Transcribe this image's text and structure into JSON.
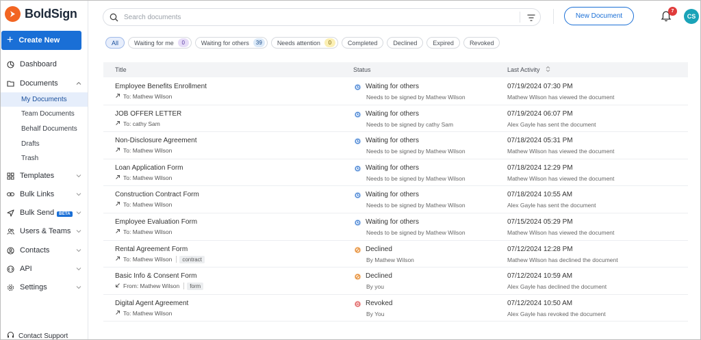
{
  "brand": {
    "name": "BoldSign",
    "accent": "#1a6fd6",
    "logo_color": "#f26522"
  },
  "sidebar": {
    "create_label": "Create New",
    "items": [
      {
        "label": "Dashboard",
        "icon": "dashboard-icon"
      },
      {
        "label": "Documents",
        "icon": "folder-icon"
      },
      {
        "label": "Templates",
        "icon": "grid-icon"
      },
      {
        "label": "Bulk Links",
        "icon": "link-icon"
      },
      {
        "label": "Bulk Send",
        "icon": "send-icon",
        "badge": "BETA"
      },
      {
        "label": "Users & Teams",
        "icon": "users-icon"
      },
      {
        "label": "Contacts",
        "icon": "contacts-icon"
      },
      {
        "label": "API",
        "icon": "api-icon"
      },
      {
        "label": "Settings",
        "icon": "gear-icon"
      }
    ],
    "documents_sub": [
      "My Documents",
      "Team Documents",
      "Behalf Documents",
      "Drafts",
      "Trash"
    ],
    "support_label": "Contact Support"
  },
  "header": {
    "search_placeholder": "Search documents",
    "new_document_label": "New Document",
    "notification_count": "7",
    "user_initials": "CS"
  },
  "filters": [
    {
      "label": "All"
    },
    {
      "label": "Waiting for me",
      "count": "0"
    },
    {
      "label": "Waiting for others",
      "count": "39"
    },
    {
      "label": "Needs attention",
      "count": "0"
    },
    {
      "label": "Completed"
    },
    {
      "label": "Declined"
    },
    {
      "label": "Expired"
    },
    {
      "label": "Revoked"
    }
  ],
  "table": {
    "columns": {
      "title": "Title",
      "status": "Status",
      "last_activity": "Last Activity"
    },
    "rows": [
      {
        "title": "Employee Benefits Enrollment",
        "party": "To: Mathew Wilson",
        "status": "Waiting for others",
        "status_detail": "Needs to be signed by Mathew Wilson",
        "date": "07/19/2024 07:30 PM",
        "activity": "Mathew Wilson has viewed the document"
      },
      {
        "title": "JOB OFFER LETTER",
        "party": "To: cathy Sam",
        "status": "Waiting for others",
        "status_detail": "Needs to be signed by cathy Sam",
        "date": "07/19/2024 06:07 PM",
        "activity": "Alex Gayle has sent the document"
      },
      {
        "title": "Non-Disclosure Agreement",
        "party": "To: Mathew Wilson",
        "status": "Waiting for others",
        "status_detail": "Needs to be signed by Mathew Wilson",
        "date": "07/18/2024 05:31 PM",
        "activity": "Mathew Wilson has viewed the document"
      },
      {
        "title": "Loan Application Form",
        "party": "To: Mathew Wilson",
        "status": "Waiting for others",
        "status_detail": "Needs to be signed by Mathew Wilson",
        "date": "07/18/2024 12:29 PM",
        "activity": "Mathew Wilson has viewed the document"
      },
      {
        "title": "Construction Contract Form",
        "party": "To: Mathew Wilson",
        "status": "Waiting for others",
        "status_detail": "Needs to be signed by Mathew Wilson",
        "date": "07/18/2024 10:55 AM",
        "activity": "Alex Gayle has sent the document"
      },
      {
        "title": "Employee Evaluation Form",
        "party": "To: Mathew Wilson",
        "status": "Waiting for others",
        "status_detail": "Needs to be signed by Mathew Wilson",
        "date": "07/15/2024 05:29 PM",
        "activity": "Mathew Wilson has viewed the document"
      },
      {
        "title": "Rental Agreement Form",
        "party": "To: Mathew Wilson",
        "tag": "contract",
        "status": "Declined",
        "status_detail": "By Mathew Wilson",
        "date": "07/12/2024 12:28 PM",
        "activity": "Mathew Wilson has declined the document"
      },
      {
        "title": "Basic Info & Consent Form",
        "party": "From: Mathew Wilson",
        "tag": "form",
        "status": "Declined",
        "status_detail": "By you",
        "date": "07/12/2024 10:59 AM",
        "activity": "Alex Gayle has declined the document"
      },
      {
        "title": "Digital Agent Agreement",
        "party": "To: Mathew Wilson",
        "status": "Revoked",
        "status_detail": "By You",
        "date": "07/12/2024 10:50 AM",
        "activity": "Alex Gayle has revoked the document"
      }
    ]
  }
}
